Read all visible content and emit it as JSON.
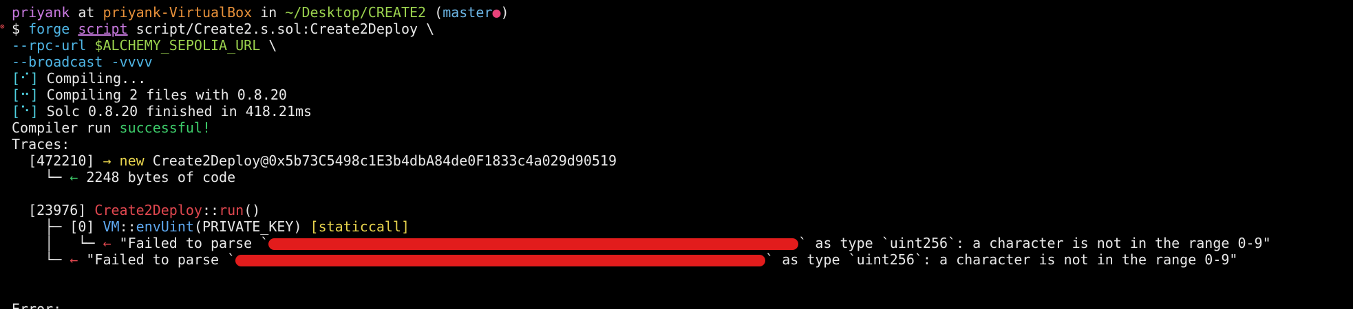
{
  "prompt": {
    "user": "priyank",
    "at": " at ",
    "host": "priyank-VirtualBox",
    "in": " in ",
    "path": "~/Desktop/CREATE2",
    "branch_open": " (",
    "branch": "master",
    "dirty_dot": "●",
    "branch_close": ")"
  },
  "error_indicator": "⊗",
  "command": {
    "dollar": "$ ",
    "tool": "forge",
    "sub": "script",
    "arg": " script/Create2.s.sol:Create2Deploy \\",
    "rpc_flag": "--rpc-url ",
    "rpc_var": "$ALCHEMY_SEPOLIA_URL",
    "rpc_tail": " \\",
    "broadcast": "--broadcast -vvvv"
  },
  "output": {
    "compiling_spinner": "[⠊]",
    "compiling_text": " Compiling...",
    "compiling2_spinner": "[⠒]",
    "compiling2_text": " Compiling 2 files with 0.8.20",
    "solc_spinner": "[⠑]",
    "solc_text": " Solc 0.8.20 finished in 418.21ms",
    "run_prefix": "Compiler run ",
    "run_status": "successful!",
    "traces_label": "Traces:",
    "trace1_gas": "  [472210] ",
    "trace1_arrow": "→ new",
    "trace1_target": " Create2Deploy@0x5b73C5498c1E3b4dbA84de0F1833c4a029d90519",
    "trace1_ret_branch": "    └─ ",
    "trace1_ret_arrow": "←",
    "trace1_ret_text": " 2248 bytes of code",
    "trace2_gas": "  [23976] ",
    "trace2_contract": "Create2Deploy",
    "trace2_sep": "::",
    "trace2_fn": "run",
    "trace2_parens": "()",
    "call_branch": "    ├─ ",
    "call_index": "[0] ",
    "call_contract": "VM",
    "call_sep": "::",
    "call_fn": "envUint",
    "call_args": "(PRIVATE_KEY) ",
    "call_kind": "[staticcall]",
    "call_ret_branch": "    │   └─ ",
    "call_ret_arrow": "←",
    "call_ret_prefix": " \"Failed to parse `",
    "call_ret_suffix": "` as type `uint256`: a character is not in the range 0-9\"",
    "final_branch": "    └─ ",
    "final_arrow": "←",
    "final_prefix": " \"Failed to parse `",
    "final_suffix": "` as type `uint256`: a character is not in the range 0-9\"",
    "error_label": "Error:"
  }
}
